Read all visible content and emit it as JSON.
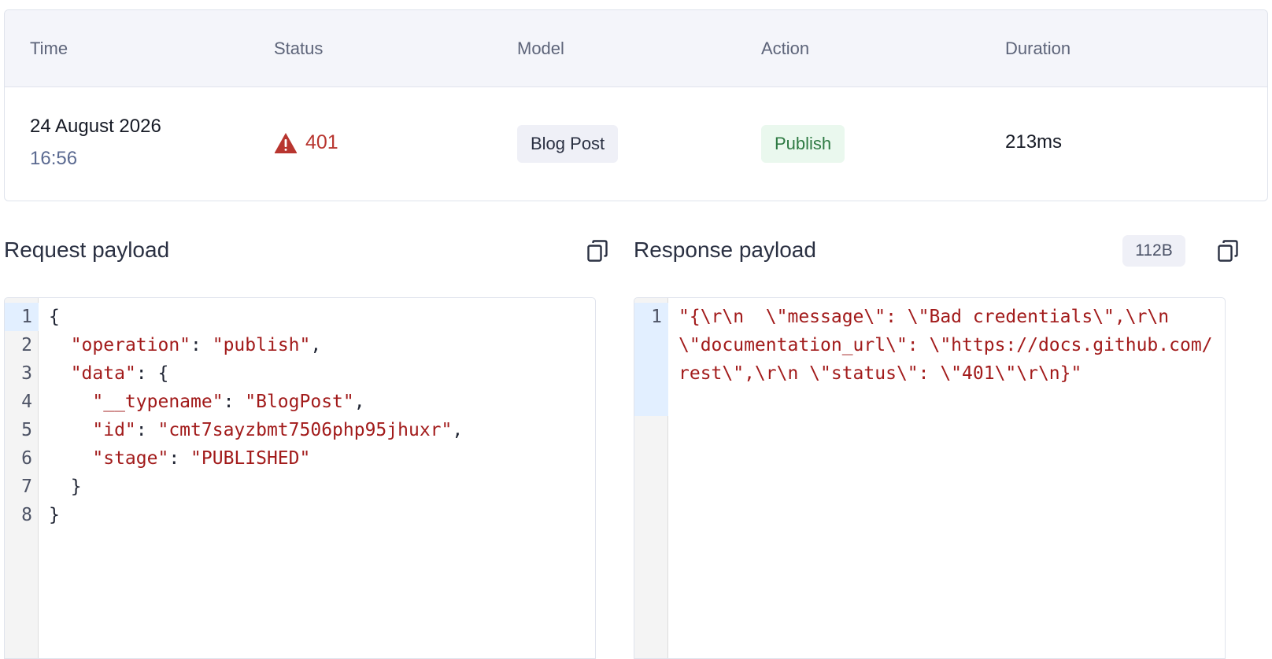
{
  "table": {
    "headers": {
      "time": "Time",
      "status": "Status",
      "model": "Model",
      "action": "Action",
      "duration": "Duration"
    },
    "row": {
      "date": "24 August 2026",
      "time": "16:56",
      "status_code": "401",
      "status_icon": "warning-triangle-icon",
      "model": "Blog Post",
      "action": "Publish",
      "duration": "213ms"
    }
  },
  "request": {
    "title": "Request payload",
    "copy_icon": "copy-icon",
    "lines": [
      {
        "n": "1",
        "pre": "{",
        "key": "",
        "mid": "",
        "val": "",
        "post": ""
      },
      {
        "n": "2",
        "pre": "  ",
        "key": "\"operation\"",
        "mid": ": ",
        "val": "\"publish\"",
        "post": ","
      },
      {
        "n": "3",
        "pre": "  ",
        "key": "\"data\"",
        "mid": ": {",
        "val": "",
        "post": ""
      },
      {
        "n": "4",
        "pre": "    ",
        "key": "\"__typename\"",
        "mid": ": ",
        "val": "\"BlogPost\"",
        "post": ","
      },
      {
        "n": "5",
        "pre": "    ",
        "key": "\"id\"",
        "mid": ": ",
        "val": "\"cmt7sayzbmt7506php95jhuxr\"",
        "post": ","
      },
      {
        "n": "6",
        "pre": "    ",
        "key": "\"stage\"",
        "mid": ": ",
        "val": "\"PUBLISHED\"",
        "post": ""
      },
      {
        "n": "7",
        "pre": "  }",
        "key": "",
        "mid": "",
        "val": "",
        "post": ""
      },
      {
        "n": "8",
        "pre": "}",
        "key": "",
        "mid": "",
        "val": "",
        "post": ""
      }
    ]
  },
  "response": {
    "title": "Response payload",
    "size": "112B",
    "copy_icon": "copy-icon",
    "line_number": "1",
    "body": "\"{\\r\\n  \\\"message\\\": \\\"Bad credentials\\\",\\r\\n  \\\"documentation_url\\\": \\\"https://docs.github.com/rest\\\",\\r\\n \\\"status\\\": \\\"401\\\"\\r\\n}\""
  },
  "colors": {
    "error": "#b8352f",
    "action_text": "#2e7a43",
    "action_bg": "#eaf8ee",
    "string": "#a21b1b"
  }
}
